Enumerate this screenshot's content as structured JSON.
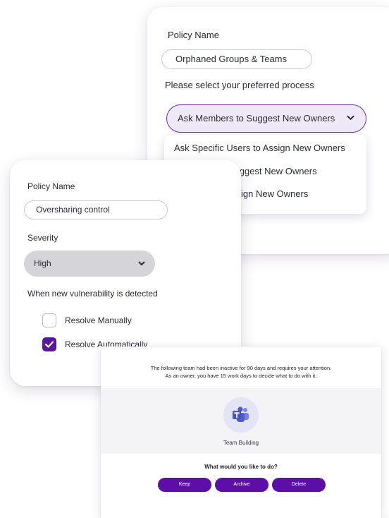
{
  "orphaned_policy": {
    "name_label": "Policy Name",
    "name_value": "Orphaned Groups & Teams",
    "process_label": "Please select your preferred process",
    "selected_process": "Ask Members to Suggest New Owners",
    "options": [
      "Ask Specific Users to Assign New Owners",
      "Ask Members to Suggest New Owners",
      "Ask Managers to Assign New Owners"
    ],
    "visible_options": [
      "Ask Specific Users to Assign New Owners",
      "o Suggest New Owners",
      "ssign New Owners"
    ]
  },
  "oversharing_policy": {
    "name_label": "Policy Name",
    "name_value": "Oversharing control",
    "severity_label": "Severity",
    "severity_value": "High",
    "vulnerability_label": "When new vulnerability is detected",
    "options": [
      {
        "label": "Resolve Manually",
        "checked": false
      },
      {
        "label": "Resolve Automatically",
        "checked": true
      }
    ]
  },
  "team_notice": {
    "message_line1": "The following team had been inactive for 90 days and requires your attention.",
    "message_line2": "As an owner, you have 15 work days to decide what to do with it.",
    "team_name": "Team Building",
    "team_icon": "teams-icon",
    "question": "What would you like to do?",
    "buttons": {
      "keep": "Keep",
      "archive": "Archive",
      "delete": "Delete"
    }
  },
  "colors": {
    "accent": "#5b0fa7",
    "select_highlight": "#efe9f7",
    "teams_icon": "#5059c9"
  }
}
